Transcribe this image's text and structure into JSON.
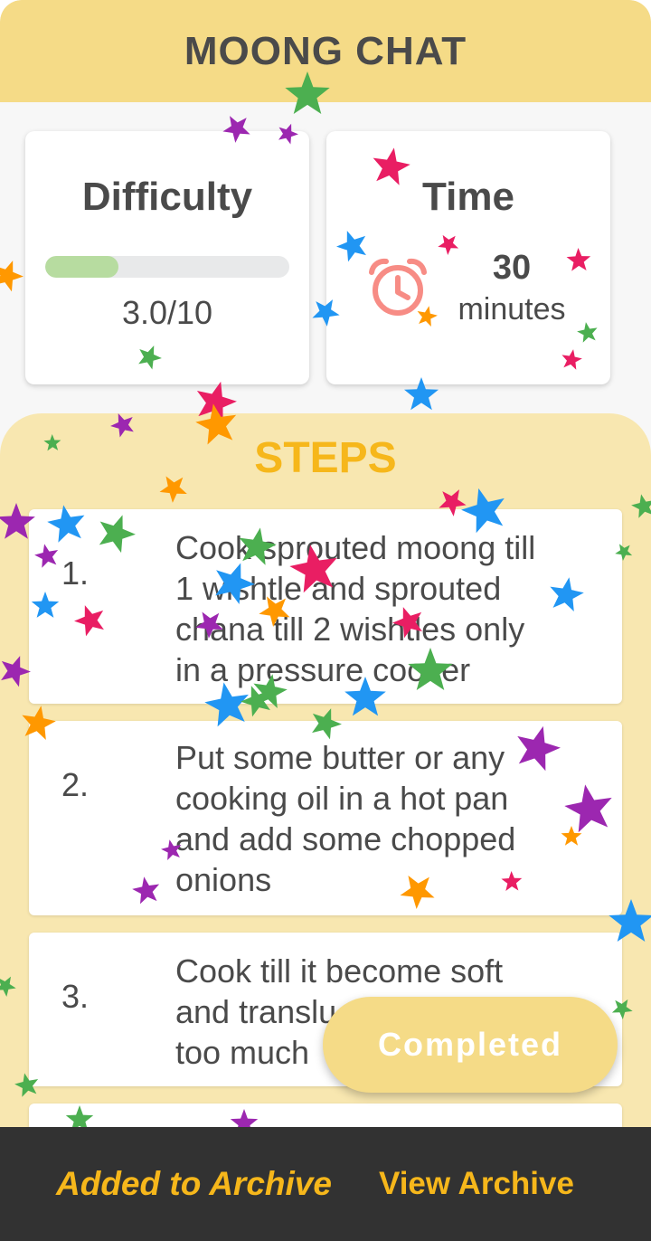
{
  "header": {
    "title": "MOONG CHAT"
  },
  "difficulty": {
    "title": "Difficulty",
    "value_text": "3.0/10",
    "fraction": 0.3
  },
  "time": {
    "title": "Time",
    "amount": "30",
    "unit": "minutes",
    "icon": "alarm-clock-icon"
  },
  "steps": {
    "title": "STEPS",
    "items": [
      {
        "number": "1.",
        "lines": [
          "Cook sprouted moong till",
          "1 wishtle and sprouted",
          "chana till 2 wishtles only",
          "in a pressure cooker"
        ]
      },
      {
        "number": "2.",
        "lines": [
          "Put some butter or any",
          "cooking oil in a hot pan",
          "and add some  chopped",
          "onions"
        ]
      },
      {
        "number": "3.",
        "lines": [
          "Cook till it become soft",
          "and translu",
          "too much"
        ]
      }
    ]
  },
  "completed_button": {
    "label": "Completed"
  },
  "snackbar": {
    "message": "Added to Archive",
    "action": "View Archive"
  },
  "colors": {
    "header": "#f5db87",
    "accent": "#f6b71b",
    "steps_bg": "#f8e7b0",
    "progress_fill": "#b7dca0",
    "clock": "#f78c85",
    "snackbar": "#323232",
    "confetti": [
      "#e91e63",
      "#2196f3",
      "#4caf50",
      "#9c27b0",
      "#ff9800"
    ]
  }
}
